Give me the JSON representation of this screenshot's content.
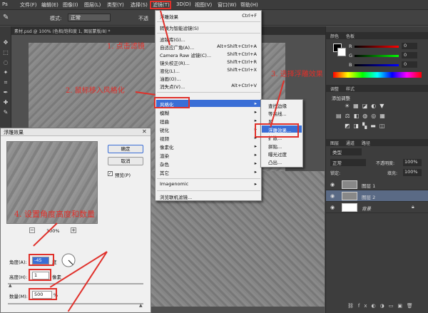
{
  "menubar": {
    "items": [
      "文件(F)",
      "编辑(E)",
      "图像(I)",
      "图层(L)",
      "类型(Y)",
      "选择(S)",
      "滤镜(T)",
      "3D(D)",
      "视图(V)",
      "窗口(W)",
      "帮助(H)"
    ]
  },
  "optbar": {
    "mode_label": "模式:",
    "mode_value": "正常",
    "opacity_label": "不透"
  },
  "doc_tab": {
    "title": "素材.psd @ 100% (色相/饱和度 1, 图层蒙版/8) *"
  },
  "filter_menu": {
    "items": [
      {
        "label": "浮雕效果",
        "shortcut": "Ctrl+F"
      },
      {
        "label": "转换为智能滤镜(S)",
        "shortcut": ""
      },
      {
        "label": "滤镜库(G)...",
        "shortcut": ""
      },
      {
        "label": "自适应广角(A)...",
        "shortcut": "Alt+Shift+Ctrl+A"
      },
      {
        "label": "Camera Raw 滤镜(C)...",
        "shortcut": "Shift+Ctrl+A"
      },
      {
        "label": "镜头校正(R)...",
        "shortcut": "Shift+Ctrl+R"
      },
      {
        "label": "液化(L)...",
        "shortcut": "Shift+Ctrl+X"
      },
      {
        "label": "油画(O)...",
        "shortcut": ""
      },
      {
        "label": "消失点(V)...",
        "shortcut": "Alt+Ctrl+V"
      },
      {
        "label": "风格化",
        "shortcut": ""
      },
      {
        "label": "模糊",
        "shortcut": ""
      },
      {
        "label": "扭曲",
        "shortcut": ""
      },
      {
        "label": "锐化",
        "shortcut": ""
      },
      {
        "label": "视频",
        "shortcut": ""
      },
      {
        "label": "像素化",
        "shortcut": ""
      },
      {
        "label": "渲染",
        "shortcut": ""
      },
      {
        "label": "杂色",
        "shortcut": ""
      },
      {
        "label": "其它",
        "shortcut": ""
      },
      {
        "label": "Imagenomic",
        "shortcut": ""
      },
      {
        "label": "浏览联机滤镜...",
        "shortcut": ""
      }
    ]
  },
  "stylize_submenu": {
    "items": [
      "查找边缘",
      "等高线...",
      "风",
      "浮雕效果...",
      "扩散...",
      "拼贴...",
      "曝光过度",
      "凸出..."
    ]
  },
  "dialog": {
    "title": "浮雕效果",
    "ok": "确定",
    "cancel": "取消",
    "preview_label": "预览(P)",
    "zoom": "100%",
    "angle_label": "角度(A):",
    "angle_value": "-45",
    "angle_unit": "度",
    "height_label": "高度(H):",
    "height_value": "1",
    "height_unit": "像素",
    "amount_label": "数量(M):",
    "amount_value": "500",
    "amount_unit": "%"
  },
  "right_panel": {
    "color_tabs": [
      "颜色",
      "色板"
    ],
    "rgb": [
      {
        "ch": "R",
        "val": "0"
      },
      {
        "ch": "G",
        "val": "0"
      },
      {
        "ch": "B",
        "val": "0"
      }
    ],
    "adjust_tabs": [
      "调整",
      "样式"
    ],
    "adjust_title": "添加调整",
    "layers_tabs": [
      "图层",
      "通道",
      "路径"
    ],
    "kind": "类型",
    "blend": "正常",
    "opacity_label": "不透明度:",
    "opacity_value": "100%",
    "lock_label": "锁定:",
    "fill_label": "填充:",
    "fill_value": "100%",
    "layers": [
      "图层 1",
      "图层 2",
      "背景"
    ]
  },
  "annotations": {
    "a1": "1. 点击滤镜",
    "a2": "2. 鼠标移入风格化",
    "a3": "3. 选择浮雕效果",
    "a4": "4. 设置角度高度和数量"
  },
  "colors": {
    "accent": "#e0302a",
    "highlight": "#3a6ed6"
  }
}
